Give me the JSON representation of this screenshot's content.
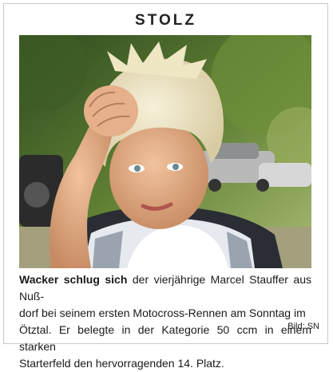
{
  "heading": "STOLZ",
  "photo": {
    "icon": "photo-boy-motocross"
  },
  "caption": {
    "lead": "Wacker schlug sich",
    "line1_rest": " der vierjährige Marcel Stauffer aus Nuß-",
    "line2": "dorf bei seinem ersten Motocross-Rennen am Sonntag im",
    "line3": "Ötztal. Er belegte in der Kategorie 50 ccm in einem starken",
    "line4": "Starterfeld den hervorragenden 14. Platz."
  },
  "credit": "Bild: SN"
}
